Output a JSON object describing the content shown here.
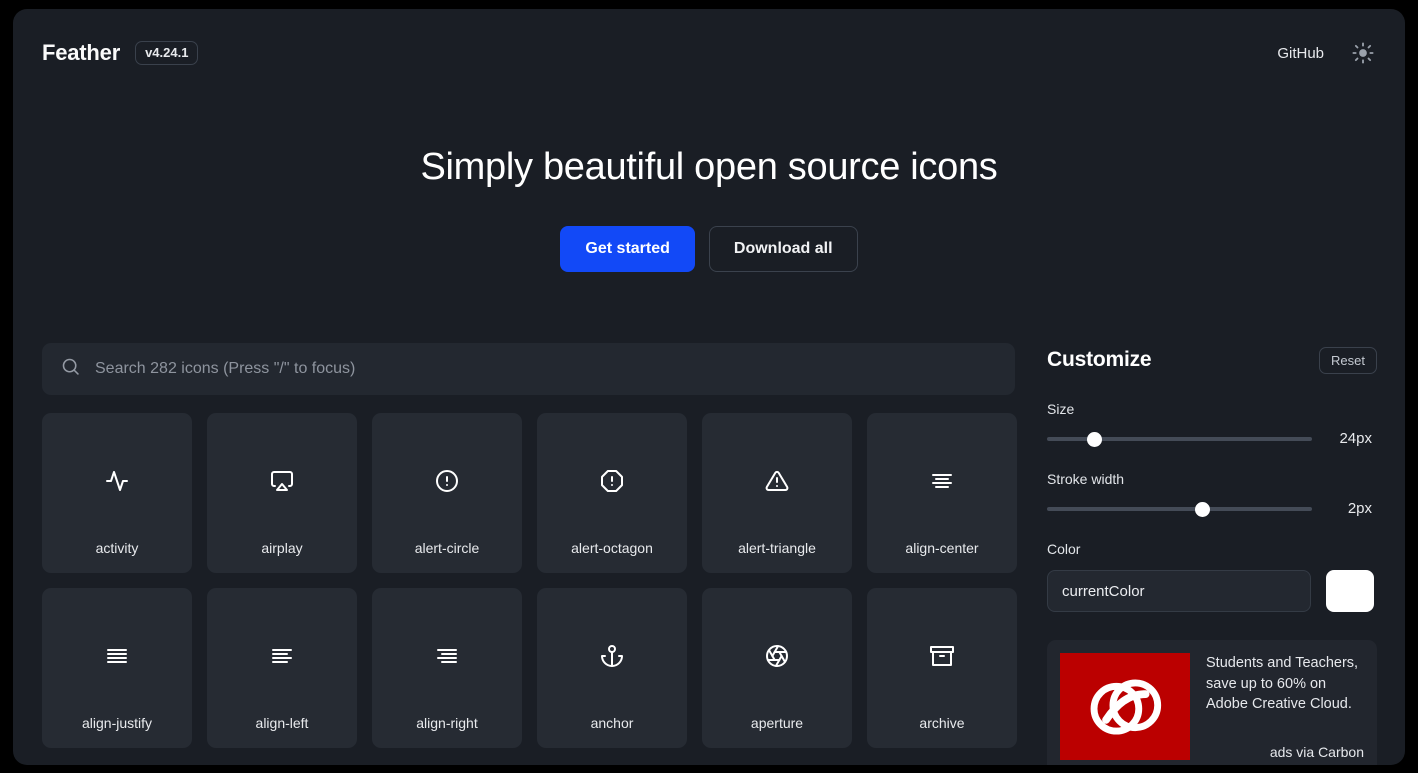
{
  "header": {
    "brand": "Feather",
    "version": "v4.24.1",
    "github_label": "GitHub",
    "theme_icon": "sun-icon"
  },
  "hero": {
    "title": "Simply beautiful open source icons",
    "primary_button": "Get started",
    "secondary_button": "Download all"
  },
  "search": {
    "icon": "search-icon",
    "placeholder": "Search 282 icons (Press \"/\" to focus)",
    "value": ""
  },
  "icons": [
    {
      "name": "activity",
      "glyph": "activity-icon"
    },
    {
      "name": "airplay",
      "glyph": "airplay-icon"
    },
    {
      "name": "alert-circle",
      "glyph": "alert-circle-icon"
    },
    {
      "name": "alert-octagon",
      "glyph": "alert-octagon-icon"
    },
    {
      "name": "alert-triangle",
      "glyph": "alert-triangle-icon"
    },
    {
      "name": "align-center",
      "glyph": "align-center-icon"
    },
    {
      "name": "align-justify",
      "glyph": "align-justify-icon"
    },
    {
      "name": "align-left",
      "glyph": "align-left-icon"
    },
    {
      "name": "align-right",
      "glyph": "align-right-icon"
    },
    {
      "name": "anchor",
      "glyph": "anchor-icon"
    },
    {
      "name": "aperture",
      "glyph": "aperture-icon"
    },
    {
      "name": "archive",
      "glyph": "archive-icon"
    }
  ],
  "customize": {
    "title": "Customize",
    "reset_label": "Reset",
    "size": {
      "label": "Size",
      "value": "24px",
      "percent": 16
    },
    "stroke": {
      "label": "Stroke width",
      "value": "2px",
      "percent": 59
    },
    "color": {
      "label": "Color",
      "value": "currentColor",
      "swatch": "#ffffff"
    }
  },
  "ad": {
    "text": "Students and Teachers, save up to 60% on Adobe Creative Cloud.",
    "via": "ads via Carbon",
    "image_alt": "adobe-creative-cloud-logo",
    "image_color": "#bb0000"
  },
  "theme": {
    "accent": "#1249f7",
    "page_bg": "#1a1e25",
    "card_bg": "#262b33"
  }
}
